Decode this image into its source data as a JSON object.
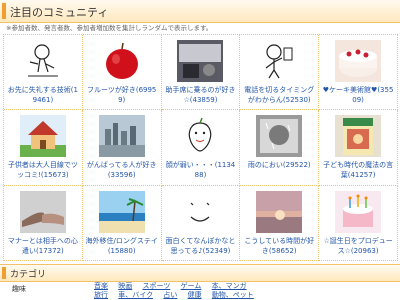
{
  "header": {
    "title": "注目のコミュニティ"
  },
  "note": "※参加者数、発言者数、参加者増加数を集計しランダムで表示します。",
  "communities": [
    {
      "label": "お先に失礼する技術(19461)",
      "icon": "drawn-figure-icon"
    },
    {
      "label": "フルーツが好き(69959)",
      "icon": "red-apple-icon"
    },
    {
      "label": "助手席に乗るのが好き☆(43859)",
      "icon": "car-seat-icon"
    },
    {
      "label": "電話を切るタイミングがわからん(52530)",
      "icon": "phone-sketch-icon"
    },
    {
      "label": "♥ケーキ美術館♥(35509)",
      "icon": "cake-icon"
    },
    {
      "label": "子供者は大人目線でツッコミ!(15673)",
      "icon": "house-icon"
    },
    {
      "label": "がんばってる人が好き(33596)",
      "icon": "city-skyline-icon"
    },
    {
      "label": "顔が弱い・・・(113488)",
      "icon": "apple-face-icon"
    },
    {
      "label": "雨のにおい(29522)",
      "icon": "rain-window-icon"
    },
    {
      "label": "子ども時代の魔法の言葉(41257)",
      "icon": "book-icon"
    },
    {
      "label": "マナーとは相手への心遣い(17372)",
      "icon": "hands-icon"
    },
    {
      "label": "海外移住/ロングステイ(15880)",
      "icon": "beach-icon"
    },
    {
      "label": "面白くてなんぼかなと思ってる♪(52349)",
      "icon": "smiley-icon"
    },
    {
      "label": "こうしている時間が好き(58652)",
      "icon": "sunset-icon"
    },
    {
      "label": "☆誕生日をプロデュース☆(20963)",
      "icon": "birthday-cake-icon"
    }
  ],
  "category": {
    "title": "カテゴリ",
    "label": "趣味",
    "links": [
      "音楽",
      "映画",
      "スポーツ",
      "ゲーム",
      "本、マンガ",
      "旅行",
      "車、バイク",
      "占い",
      "健康",
      "動物、ペット"
    ]
  }
}
